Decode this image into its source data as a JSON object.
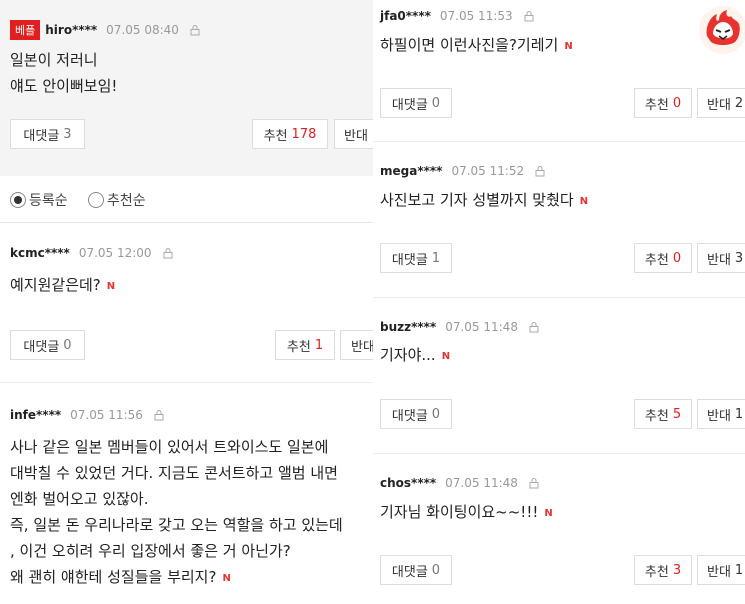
{
  "best": {
    "badge": "베플",
    "user": "hiro****",
    "time": "07.05 08:40",
    "lines": [
      "일본이 저러니",
      "얘도 안이뻐보임!"
    ],
    "reply_label": "대댓글",
    "reply_count": "3",
    "like_label": "추천",
    "like_count": "178",
    "dislike_label": "반대"
  },
  "sort": {
    "option_registered": "등록순",
    "option_recommended": "추천순"
  },
  "left_comments": [
    {
      "user": "kcmc****",
      "time": "07.05 12:00",
      "lines": [
        "예지원같은데?"
      ],
      "reply_label": "대댓글",
      "reply_count": "0",
      "like_label": "추천",
      "like_count": "1",
      "dislike_label": "반대"
    },
    {
      "user": "infe****",
      "time": "07.05 11:56",
      "lines": [
        "사나 같은 일본 멤버들이 있어서 트와이스도 일본에",
        "대박칠 수 있었던 거다. 지금도 콘서트하고 앨범 내면",
        "엔화 벌어오고 있잖아.",
        "즉, 일본 돈 우리나라로 갖고 오는 역할을 하고 있는데",
        ", 이건 오히려 우리 입장에서 좋은 거 아닌가?",
        "왜 괜히 얘한테 성질들을 부리지?"
      ]
    }
  ],
  "right_comments": [
    {
      "user": "jfa0****",
      "time": "07.05 11:53",
      "text": "하필이면 이런사진을?기레기",
      "reply_label": "대댓글",
      "reply_count": "0",
      "like_label": "추천",
      "like_count": "0",
      "dislike_label": "반대",
      "dislike_count": "2"
    },
    {
      "user": "mega****",
      "time": "07.05 11:52",
      "text": "사진보고 기자 성별까지 맞췄다",
      "reply_label": "대댓글",
      "reply_count": "1",
      "like_label": "추천",
      "like_count": "0",
      "dislike_label": "반대",
      "dislike_count": "3"
    },
    {
      "user": "buzz****",
      "time": "07.05 11:48",
      "text": "기자야...",
      "reply_label": "대댓글",
      "reply_count": "0",
      "like_label": "추천",
      "like_count": "5",
      "dislike_label": "반대",
      "dislike_count": "1"
    },
    {
      "user": "chos****",
      "time": "07.05 11:48",
      "text": "기자님 화이팅이요~~!!!",
      "reply_label": "대댓글",
      "reply_count": "0",
      "like_label": "추천",
      "like_count": "3",
      "dislike_label": "반대",
      "dislike_count": "1"
    }
  ],
  "new_mark": "N",
  "icons": {
    "lock": "lock-icon",
    "avatar": "phoenix-avatar-icon"
  },
  "colors": {
    "accent_red": "#e02020",
    "best_bg": "#f4f4f4"
  }
}
